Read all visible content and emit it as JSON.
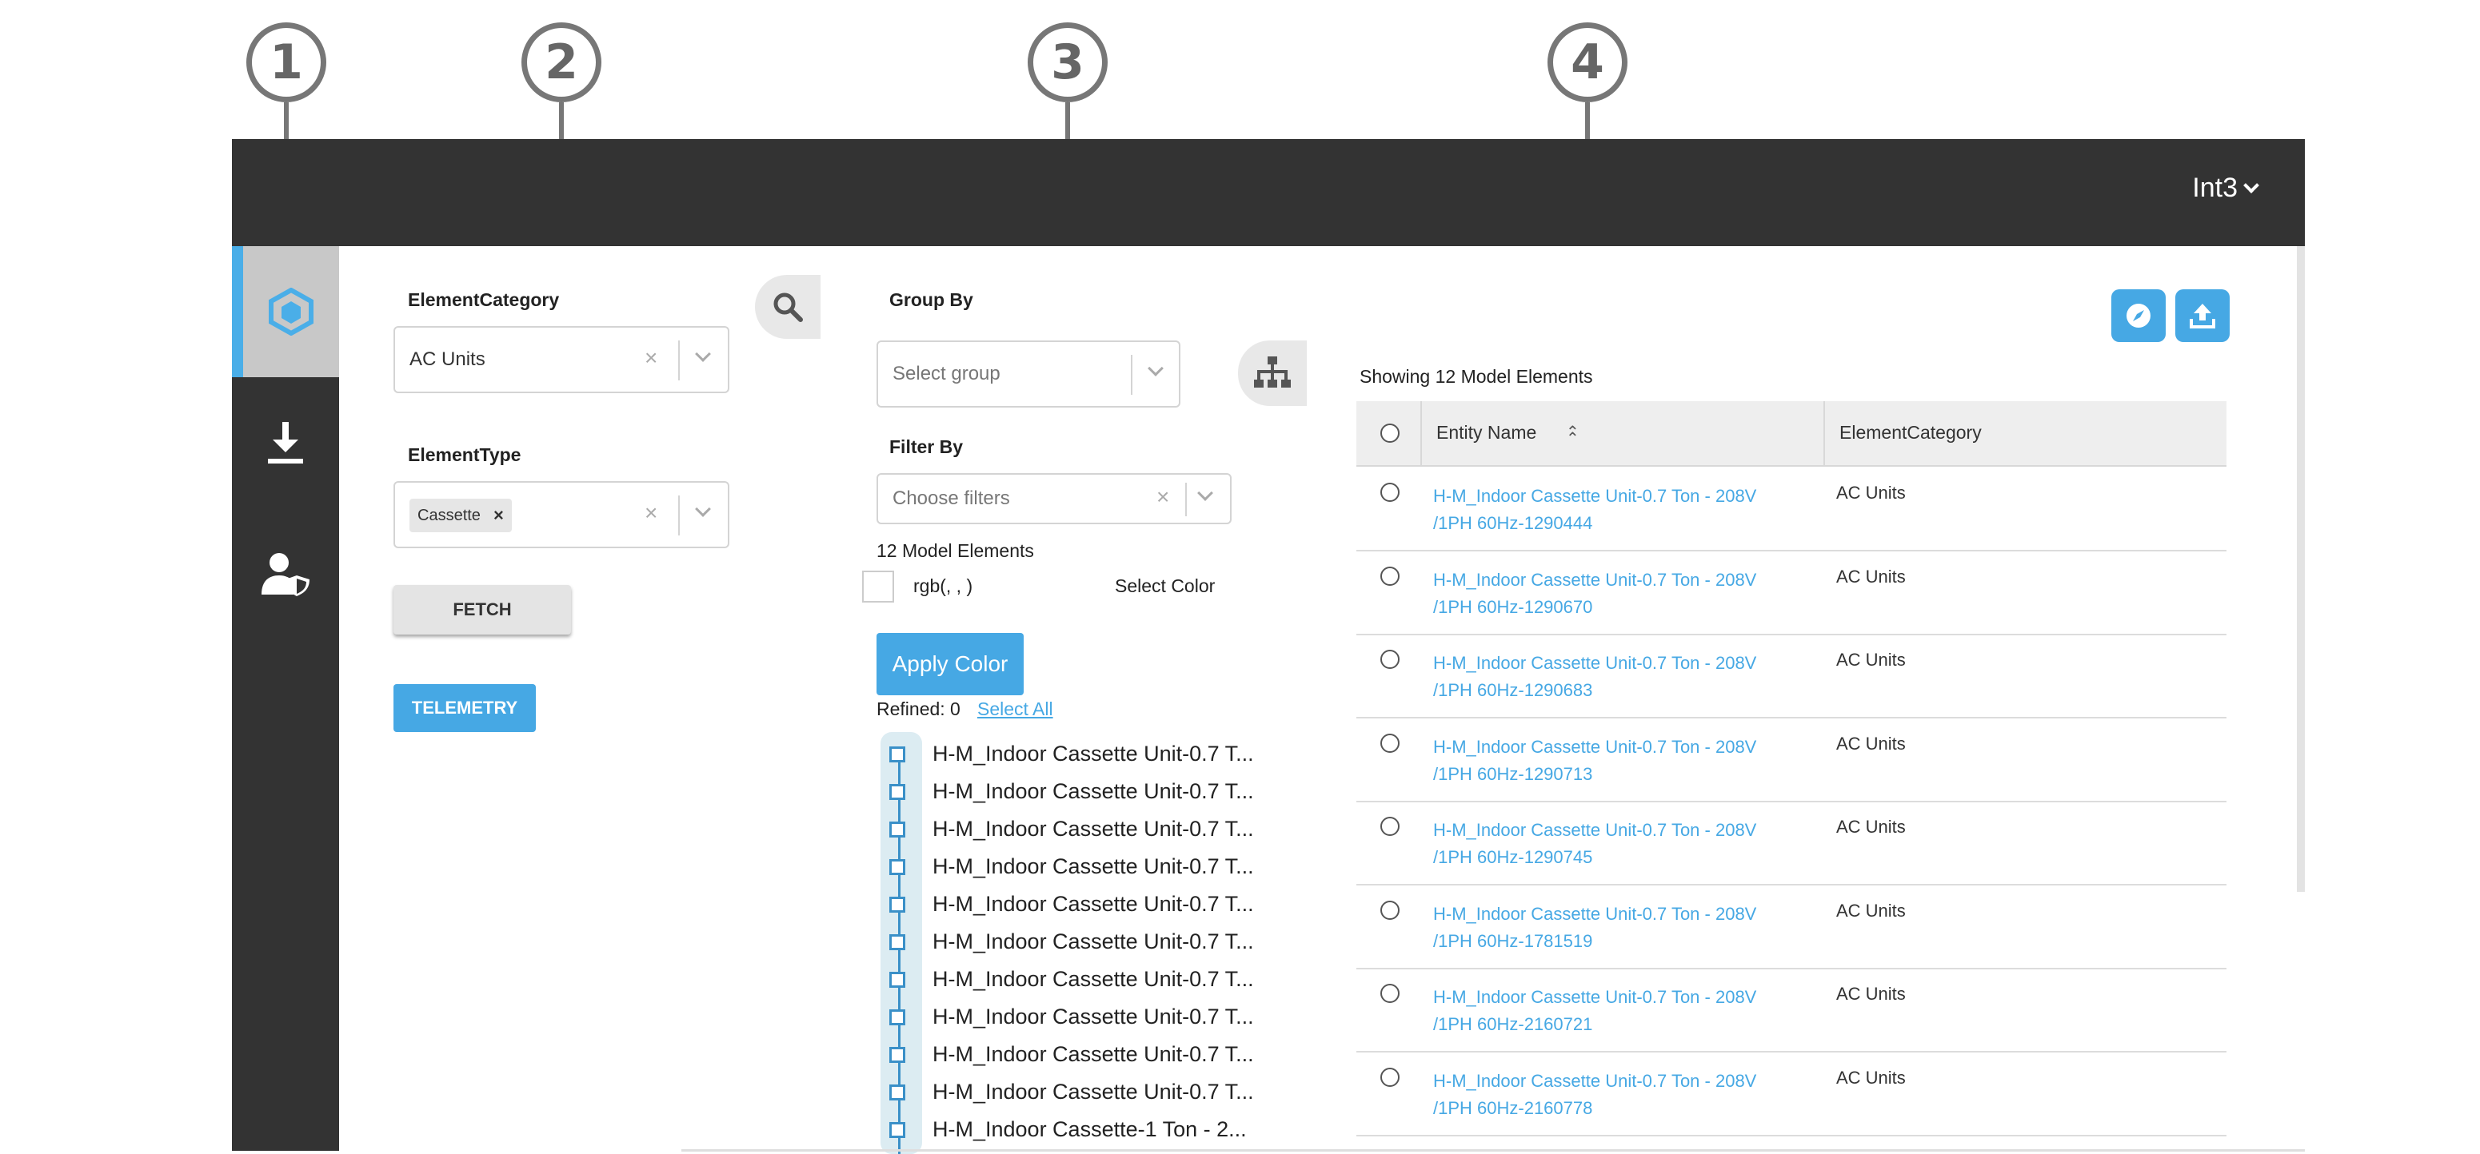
{
  "callouts": [
    "1",
    "2",
    "3",
    "4"
  ],
  "header": {
    "user": "Int3"
  },
  "sidebar": {
    "items": [
      "model-cube-icon",
      "download-icon",
      "user-shield-icon"
    ]
  },
  "filters": {
    "element_category_label": "ElementCategory",
    "element_category_value": "AC Units",
    "element_type_label": "ElementType",
    "element_type_tag": "Cassette",
    "fetch_label": "FETCH",
    "telemetry_label": "TELEMETRY"
  },
  "grouping": {
    "group_by_label": "Group By",
    "group_placeholder": "Select group",
    "filter_by_label": "Filter By",
    "filter_placeholder": "Choose filters",
    "model_count": "12 Model Elements",
    "color_value": "rgb(, , )",
    "select_color_label": "Select Color",
    "apply_color_label": "Apply Color",
    "refined": "Refined: 0",
    "select_all": "Select All",
    "tree_items": [
      "H-M_Indoor Cassette Unit-0.7 T...",
      "H-M_Indoor Cassette Unit-0.7 T...",
      "H-M_Indoor Cassette Unit-0.7 T...",
      "H-M_Indoor Cassette Unit-0.7 T...",
      "H-M_Indoor Cassette Unit-0.7 T...",
      "H-M_Indoor Cassette Unit-0.7 T...",
      "H-M_Indoor Cassette Unit-0.7 T...",
      "H-M_Indoor Cassette Unit-0.7 T...",
      "H-M_Indoor Cassette Unit-0.7 T...",
      "H-M_Indoor Cassette Unit-0.7 T...",
      "H-M_Indoor Cassette-1 Ton - 2..."
    ]
  },
  "results": {
    "showing": "Showing 12 Model Elements",
    "col_entity": "Entity Name",
    "col_category": "ElementCategory",
    "rows": [
      {
        "name1": "H-M_Indoor Cassette Unit-0.7 Ton - 208V",
        "name2": "/1PH 60Hz-1290444",
        "category": "AC Units"
      },
      {
        "name1": "H-M_Indoor Cassette Unit-0.7 Ton - 208V",
        "name2": "/1PH 60Hz-1290670",
        "category": "AC Units"
      },
      {
        "name1": "H-M_Indoor Cassette Unit-0.7 Ton - 208V",
        "name2": "/1PH 60Hz-1290683",
        "category": "AC Units"
      },
      {
        "name1": "H-M_Indoor Cassette Unit-0.7 Ton - 208V",
        "name2": "/1PH 60Hz-1290713",
        "category": "AC Units"
      },
      {
        "name1": "H-M_Indoor Cassette Unit-0.7 Ton - 208V",
        "name2": "/1PH 60Hz-1290745",
        "category": "AC Units"
      },
      {
        "name1": "H-M_Indoor Cassette Unit-0.7 Ton - 208V",
        "name2": "/1PH 60Hz-1781519",
        "category": "AC Units"
      },
      {
        "name1": "H-M_Indoor Cassette Unit-0.7 Ton - 208V",
        "name2": "/1PH 60Hz-2160721",
        "category": "AC Units"
      },
      {
        "name1": "H-M_Indoor Cassette Unit-0.7 Ton - 208V",
        "name2": "/1PH 60Hz-2160778",
        "category": "AC Units"
      }
    ]
  },
  "colors": {
    "accent": "#46a8e4",
    "dark": "#333333"
  }
}
